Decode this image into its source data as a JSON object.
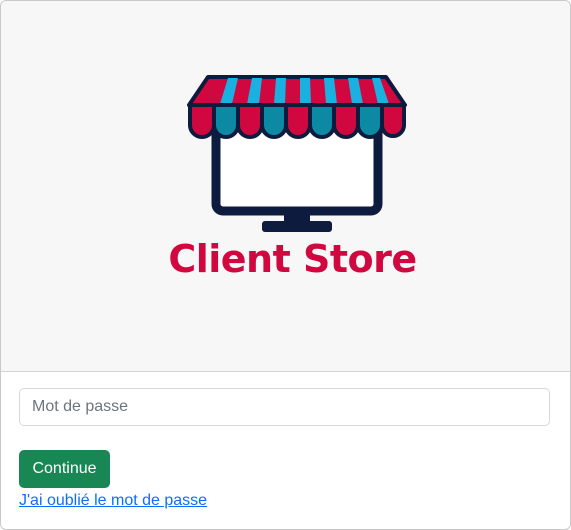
{
  "brand": {
    "name": "Client Store",
    "logo_icon": "storefront-monitor-icon",
    "colors": {
      "primary": "#d0083f",
      "awning_blue": "#1ab0e0",
      "awning_teal": "#0d8aa3",
      "outline": "#0d1b3e"
    }
  },
  "form": {
    "password_placeholder": "Mot de passe",
    "password_value": "",
    "continue_label": "Continue",
    "forgot_link": "J'ai oublié le mot de passe"
  },
  "theme": {
    "button_color": "#198754",
    "link_color": "#0d6efd"
  }
}
